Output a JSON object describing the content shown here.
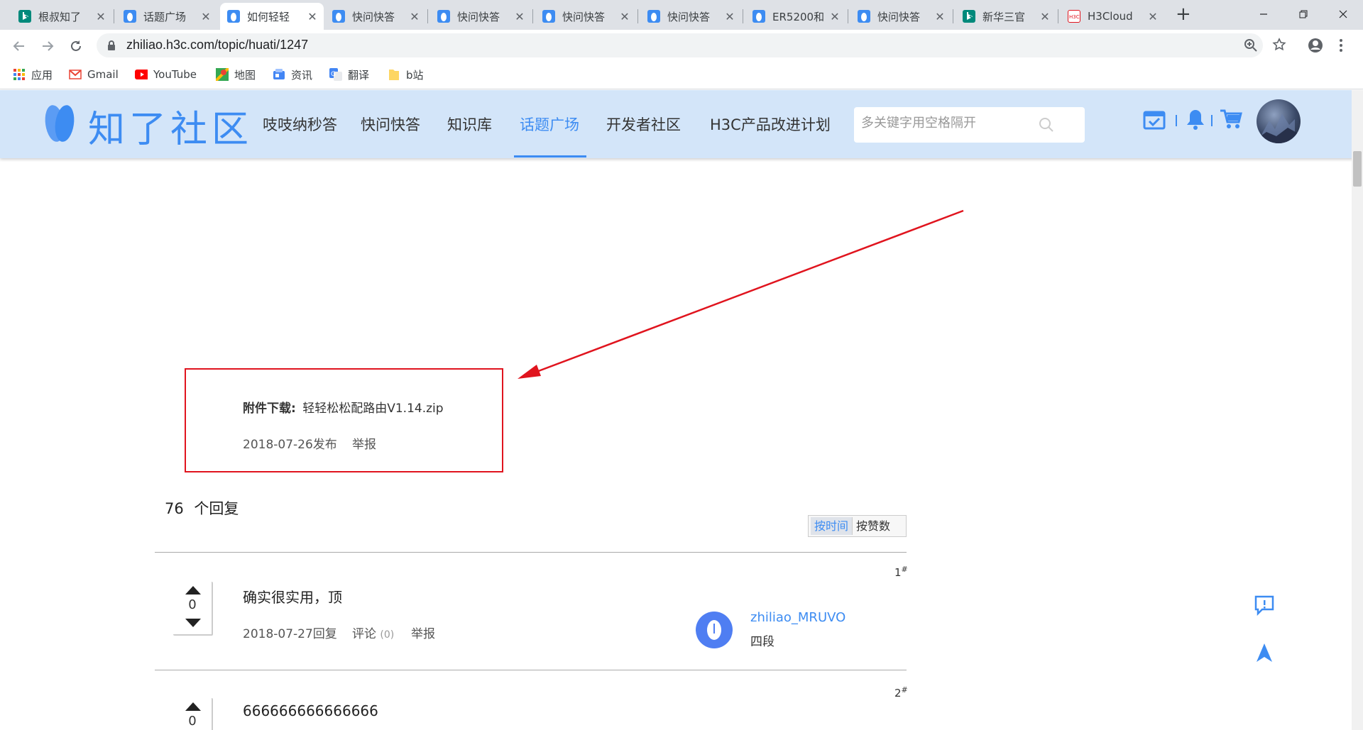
{
  "browser": {
    "tabs": [
      {
        "title": "根叔知了"
      },
      {
        "title": "话题广场"
      },
      {
        "title": "如何轻轻"
      },
      {
        "title": "快问快答"
      },
      {
        "title": "快问快答"
      },
      {
        "title": "快问快答"
      },
      {
        "title": "快问快答"
      },
      {
        "title": "ER5200和"
      },
      {
        "title": "快问快答"
      },
      {
        "title": "新华三官"
      },
      {
        "title": "H3Cloud"
      }
    ],
    "new_tab": "+",
    "url": "zhiliao.h3c.com/topic/huati/1247",
    "bookmarks": [
      {
        "label": "应用"
      },
      {
        "label": "Gmail"
      },
      {
        "label": "YouTube"
      },
      {
        "label": "地图"
      },
      {
        "label": "资讯"
      },
      {
        "label": "翻译"
      },
      {
        "label": "b站"
      }
    ]
  },
  "site": {
    "logo": "知了社区",
    "nav": [
      "吱吱纳秒答",
      "快问快答",
      "知识库",
      "话题广场",
      "开发者社区",
      "H3C产品改进计划"
    ],
    "search_placeholder": "多关键字用空格隔开"
  },
  "post": {
    "attachment_label": "附件下载:",
    "attachment_file": "轻轻松松配路由V1.14.zip",
    "date": "2018-07-26发布",
    "report": "举报"
  },
  "replies": {
    "count": "76",
    "count_label": "个回复",
    "sort": [
      "按时间",
      "按赞数"
    ],
    "items": [
      {
        "floor": "1",
        "votes": "0",
        "content": "确实很实用，顶",
        "date": "2018-07-27回复",
        "comment": "评论",
        "comment_count": "(0)",
        "report": "举报",
        "user": "zhiliao_MRUVO",
        "rank": "四段"
      },
      {
        "floor": "2",
        "votes": "0",
        "content": "666666666666666"
      }
    ]
  },
  "colors": {
    "brand": "#3d8cf2",
    "header_bg": "#d3e5f9",
    "annotation": "#e0141e"
  }
}
